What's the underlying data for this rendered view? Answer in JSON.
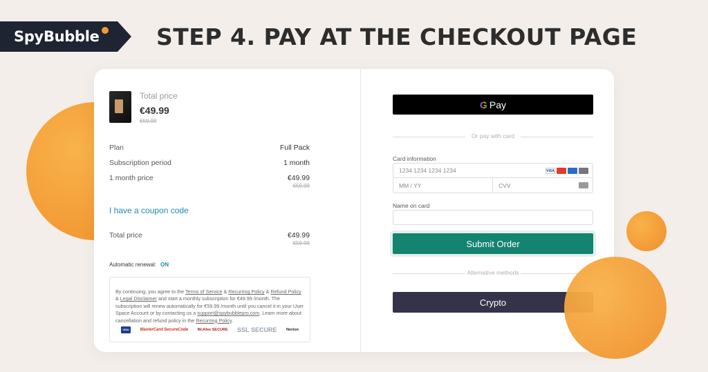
{
  "brand": {
    "name": "SpyBubble"
  },
  "heading": "STEP 4. PAY AT THE CHECKOUT PAGE",
  "summary": {
    "total_label": "Total price",
    "price": "€49.99",
    "old_price": "€59.99",
    "rows": [
      {
        "label": "Plan",
        "value": "Full Pack"
      },
      {
        "label": "Subscription period",
        "value": "1 month"
      },
      {
        "label": "1 month price",
        "value": "€49.99",
        "old": "€59.99"
      }
    ],
    "coupon_link": "I have a coupon code",
    "total": {
      "label": "Total price",
      "value": "€49.99",
      "old": "€59.99"
    },
    "renewal_label": "Automatic renewal:",
    "renewal_value": "ON",
    "legal": {
      "p1": "By continuing, you agree to the ",
      "terms": "Terms of Service",
      "p2": " & ",
      "recurring": "Recurring Policy",
      "p3": " & ",
      "refund": "Refund Policy",
      "p4": " & ",
      "disclaimer": "Legal Disclaimer",
      "p5": " and start a monthly subscription for €49.99 /month. The subscription will renew automatically for €59.99 /month until you cancel it in your User Space Account or by contacting us a ",
      "email": "support@spybubblepro.com",
      "p6": ". Learn more about cancellation and refund policy in the ",
      "recurring2": "Recurring Policy",
      "p7": "."
    },
    "badges": [
      "VISA",
      "MasterCard SecureCode",
      "McAfee SECURE",
      "SSL SECURE",
      "Norton"
    ]
  },
  "payment": {
    "gpay_label": "Pay",
    "gpay_g": "G",
    "or_card": "Or pay with card",
    "card_info_label": "Card information",
    "card_number_placeholder": "1234 1234 1234 1234",
    "expiry_placeholder": "MM / YY",
    "cvv_placeholder": "CVV",
    "name_label": "Name on card",
    "name_placeholder": "",
    "submit_label": "Submit Order",
    "alt_methods": "Alternative methods",
    "crypto_label": "Crypto",
    "card_brands": [
      "VISA",
      "mastercard",
      "amex",
      "discover"
    ]
  },
  "colors": {
    "brand_dark": "#1f2433",
    "accent_orange": "#f39a2f",
    "submit_green": "#14836f",
    "crypto_dark": "#34334a",
    "link_blue": "#1f88b8"
  }
}
